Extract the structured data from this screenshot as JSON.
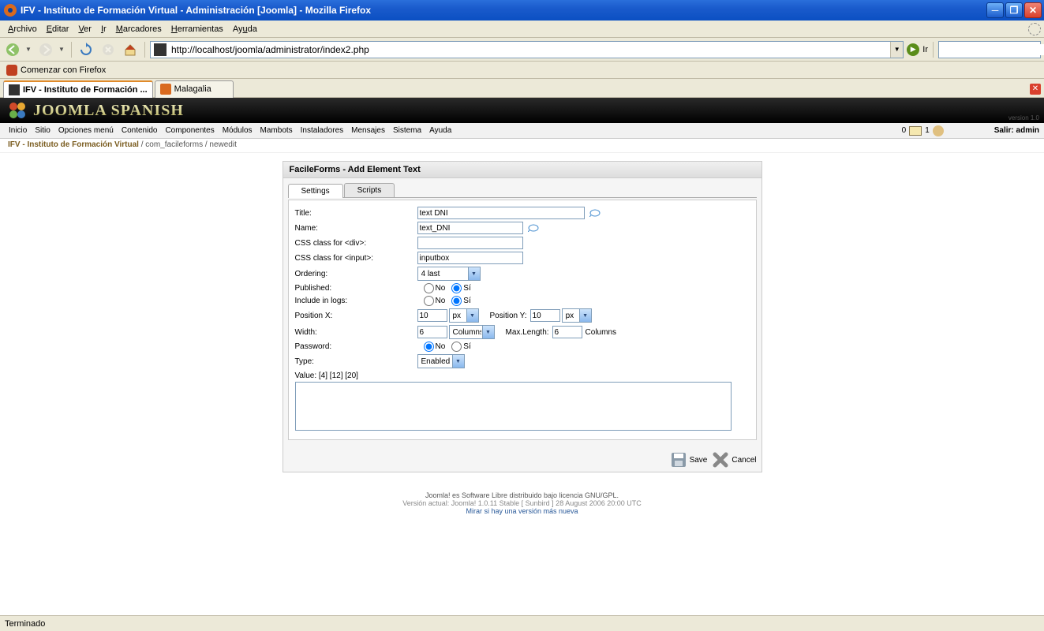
{
  "window": {
    "title": "IFV - Instituto de Formación Virtual - Administración [Joomla] - Mozilla Firefox"
  },
  "firefox_menu": [
    "Archivo",
    "Editar",
    "Ver",
    "Ir",
    "Marcadores",
    "Herramientas",
    "Ayuda"
  ],
  "nav": {
    "url": "http://localhost/joomla/administrator/index2.php",
    "ir": "Ir"
  },
  "bookmarks": {
    "item1": "Comenzar con Firefox"
  },
  "tabs": {
    "t1": "IFV - Instituto de Formación ...",
    "t2": "Malagalia"
  },
  "joomla": {
    "brand": "JOOMLA SPANISH",
    "version": "version 1.0",
    "menu": [
      "Inicio",
      "Sitio",
      "Opciones menú",
      "Contenido",
      "Componentes",
      "Módulos",
      "Mambots",
      "Instaladores",
      "Mensajes",
      "Sistema",
      "Ayuda"
    ],
    "msg_count": "0",
    "user_count": "1",
    "salir": "Salir: admin",
    "breadcrumb_main": "IFV - Instituto de Formación Virtual",
    "breadcrumb_rest": " / com_facileforms / newedit"
  },
  "panel": {
    "title": "FacileForms - Add Element Text",
    "tabs": {
      "settings": "Settings",
      "scripts": "Scripts"
    },
    "labels": {
      "title": "Title:",
      "name": "Name:",
      "css_div": "CSS class for <div>:",
      "css_input": "CSS class for <input>:",
      "ordering": "Ordering:",
      "published": "Published:",
      "include": "Include in logs:",
      "posx": "Position X:",
      "posy": "Position Y:",
      "width": "Width:",
      "maxlen": "Max.Length:",
      "columns": "Columns",
      "password": "Password:",
      "type": "Type:",
      "value": "Value: [4] [12] [20]",
      "no": "No",
      "si": "Sí"
    },
    "values": {
      "title": "text DNI",
      "name": "text_DNI",
      "css_div": "",
      "css_input": "inputbox",
      "ordering": "4 last",
      "posx": "10",
      "posx_unit": "px",
      "posy": "10",
      "posy_unit": "px",
      "width": "6",
      "width_unit": "Columns",
      "maxlen": "6",
      "type": "Enabled",
      "value_text": ""
    },
    "actions": {
      "save": "Save",
      "cancel": "Cancel"
    }
  },
  "footer": {
    "l1": "Joomla! es Software Libre distribuido bajo licencia GNU/GPL.",
    "l2": "Versión actual: Joomla! 1.0.11 Stable [ Sunbird ] 28 August 2006 20:00 UTC",
    "l3": "Mirar si hay una versión más nueva"
  },
  "status": "Terminado"
}
